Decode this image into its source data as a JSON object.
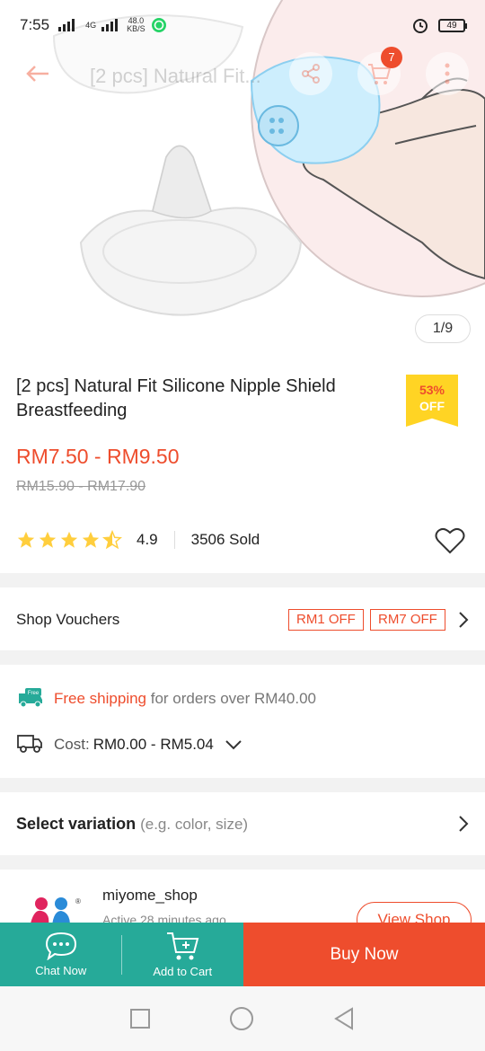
{
  "status_bar": {
    "time": "7:55",
    "net_speed_value": "48.0",
    "net_speed_unit": "KB/S",
    "net_type": "4G",
    "battery": "49"
  },
  "top_bar": {
    "title": "[2 pcs] Natural Fit...",
    "cart_count": "7"
  },
  "gallery": {
    "counter": "1/9"
  },
  "product": {
    "title": "[2 pcs] Natural Fit Silicone Nipple Shield Breastfeeding",
    "discount_percent": "53%",
    "discount_off": "OFF",
    "price": "RM7.50 - RM9.50",
    "original_price": "RM15.90 - RM17.90",
    "rating": "4.9",
    "rating_stars": 4.5,
    "sold": "3506 Sold"
  },
  "vouchers": {
    "label": "Shop Vouchers",
    "items": [
      "RM1 OFF",
      "RM7 OFF"
    ]
  },
  "shipping": {
    "free_badge": "Free",
    "free_text": "Free shipping",
    "free_condition": "for orders over RM40.00",
    "cost_label": "Cost:",
    "cost_value": "RM0.00 - RM5.04"
  },
  "variation": {
    "label": "Select variation",
    "hint": "(e.g. color, size)"
  },
  "shop": {
    "name": "miyome_shop",
    "active": "Active 28 minutes ago",
    "view_button": "View Shop"
  },
  "actions": {
    "chat": "Chat Now",
    "add_to_cart": "Add to Cart",
    "buy_now": "Buy Now"
  },
  "colors": {
    "brand": "#ee4d2d",
    "green": "#26aa99",
    "discount_bg": "#ffd424"
  }
}
